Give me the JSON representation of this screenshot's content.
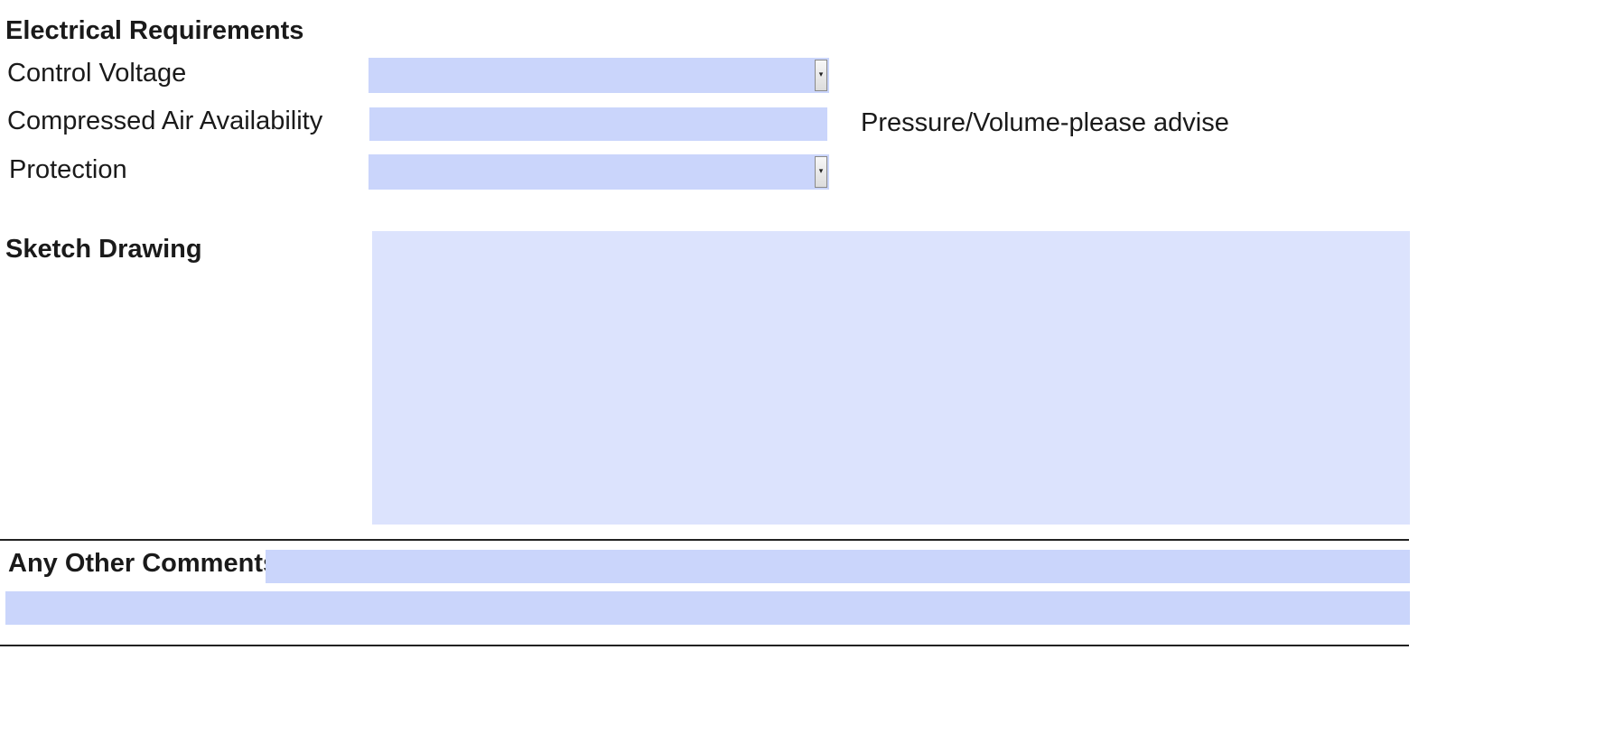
{
  "electrical": {
    "heading": "Electrical Requirements",
    "control_voltage_label": "Control Voltage",
    "control_voltage_value": "",
    "compressed_air_label": "Compressed Air Availability",
    "compressed_air_value": "",
    "compressed_air_hint": "Pressure/Volume-please advise",
    "protection_label": "Protection",
    "protection_value": ""
  },
  "sketch": {
    "heading": "Sketch Drawing",
    "value": ""
  },
  "comments": {
    "label": "Any Other Comments:",
    "line1_value": "",
    "line2_value": ""
  },
  "colors": {
    "field_fill": "#cad5fb",
    "sketch_fill": "#dce3fd",
    "text": "#1a1a1a",
    "rule": "#222222"
  },
  "icons": {
    "dropdown": "chevron-down-icon"
  }
}
